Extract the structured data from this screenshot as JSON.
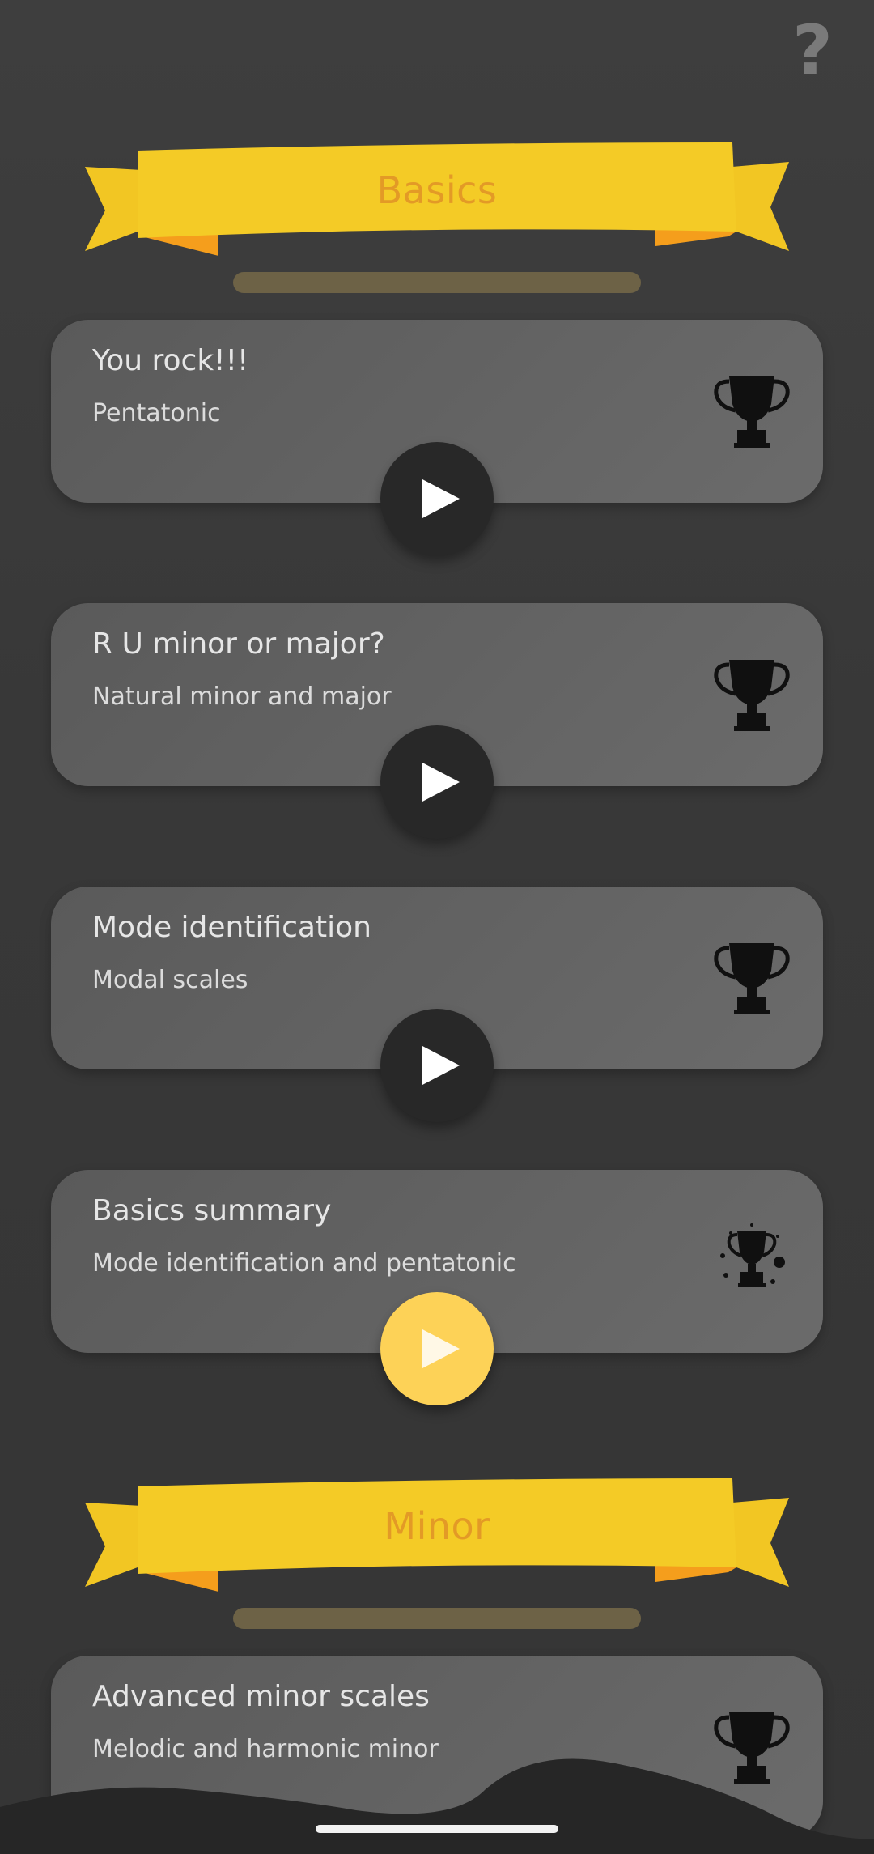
{
  "help": {
    "label": "?"
  },
  "sections": [
    {
      "title": "Basics"
    },
    {
      "title": "Minor"
    }
  ],
  "lessons": [
    {
      "title": "You rock!!!",
      "subtitle": "Pentatonic",
      "trophy": "trophy-icon",
      "play_state": "done"
    },
    {
      "title": "R U minor or major?",
      "subtitle": "Natural minor and major",
      "trophy": "trophy-icon",
      "play_state": "done"
    },
    {
      "title": "Mode identification",
      "subtitle": "Modal scales",
      "trophy": "trophy-icon",
      "play_state": "done"
    },
    {
      "title": "Basics summary",
      "subtitle": "Mode identification and pentatonic",
      "trophy": "trophy-sparkle-icon",
      "play_state": "current"
    },
    {
      "title": "Advanced minor scales",
      "subtitle": "Melodic and harmonic minor",
      "trophy": "trophy-icon",
      "play_state": "locked"
    }
  ],
  "colors": {
    "background": "#383838",
    "banner": "#f4cb26",
    "banner_title": "#e39a26",
    "card": "#636363",
    "play_button": "#282828",
    "play_button_current": "#fdd257"
  }
}
